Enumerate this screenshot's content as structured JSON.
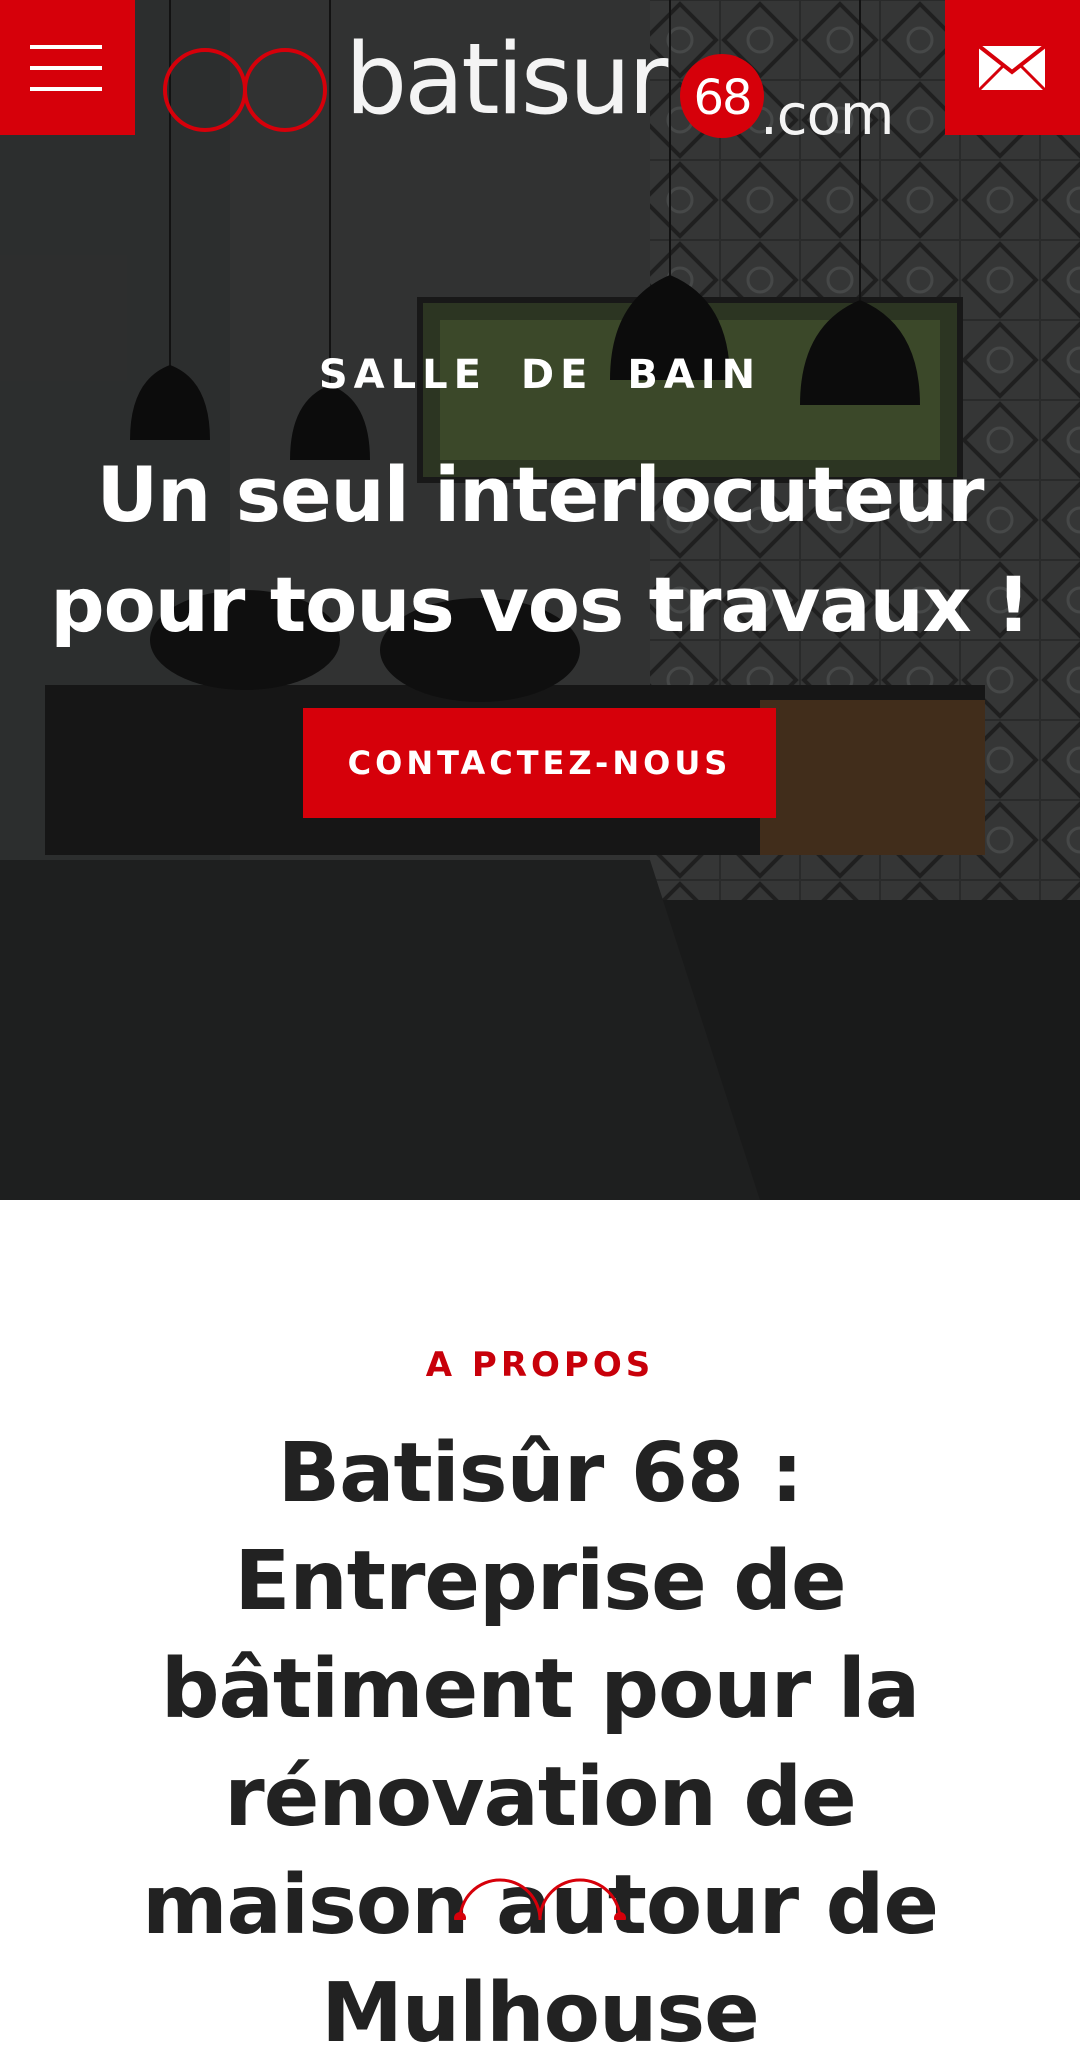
{
  "header": {
    "logo_text": "batisur",
    "logo_number": "68",
    "logo_suffix": ".com",
    "menu_icon": "hamburger-menu-icon",
    "mail_icon": "envelope-icon"
  },
  "hero": {
    "kicker": "SALLE  DE  BAIN",
    "title": "Un seul interlocuteur pour tous vos travaux !",
    "cta_label": "CONTACTEZ-NOUS"
  },
  "about": {
    "kicker": "A PROPOS",
    "title": "Batisûr 68 : Entreprise de bâtiment pour la rénovation de maison autour de Mulhouse",
    "ornament_icon": "double-circle-logo-icon"
  },
  "colors": {
    "brand_red": "#d6000a",
    "heading_dark": "#222222",
    "white": "#ffffff"
  }
}
